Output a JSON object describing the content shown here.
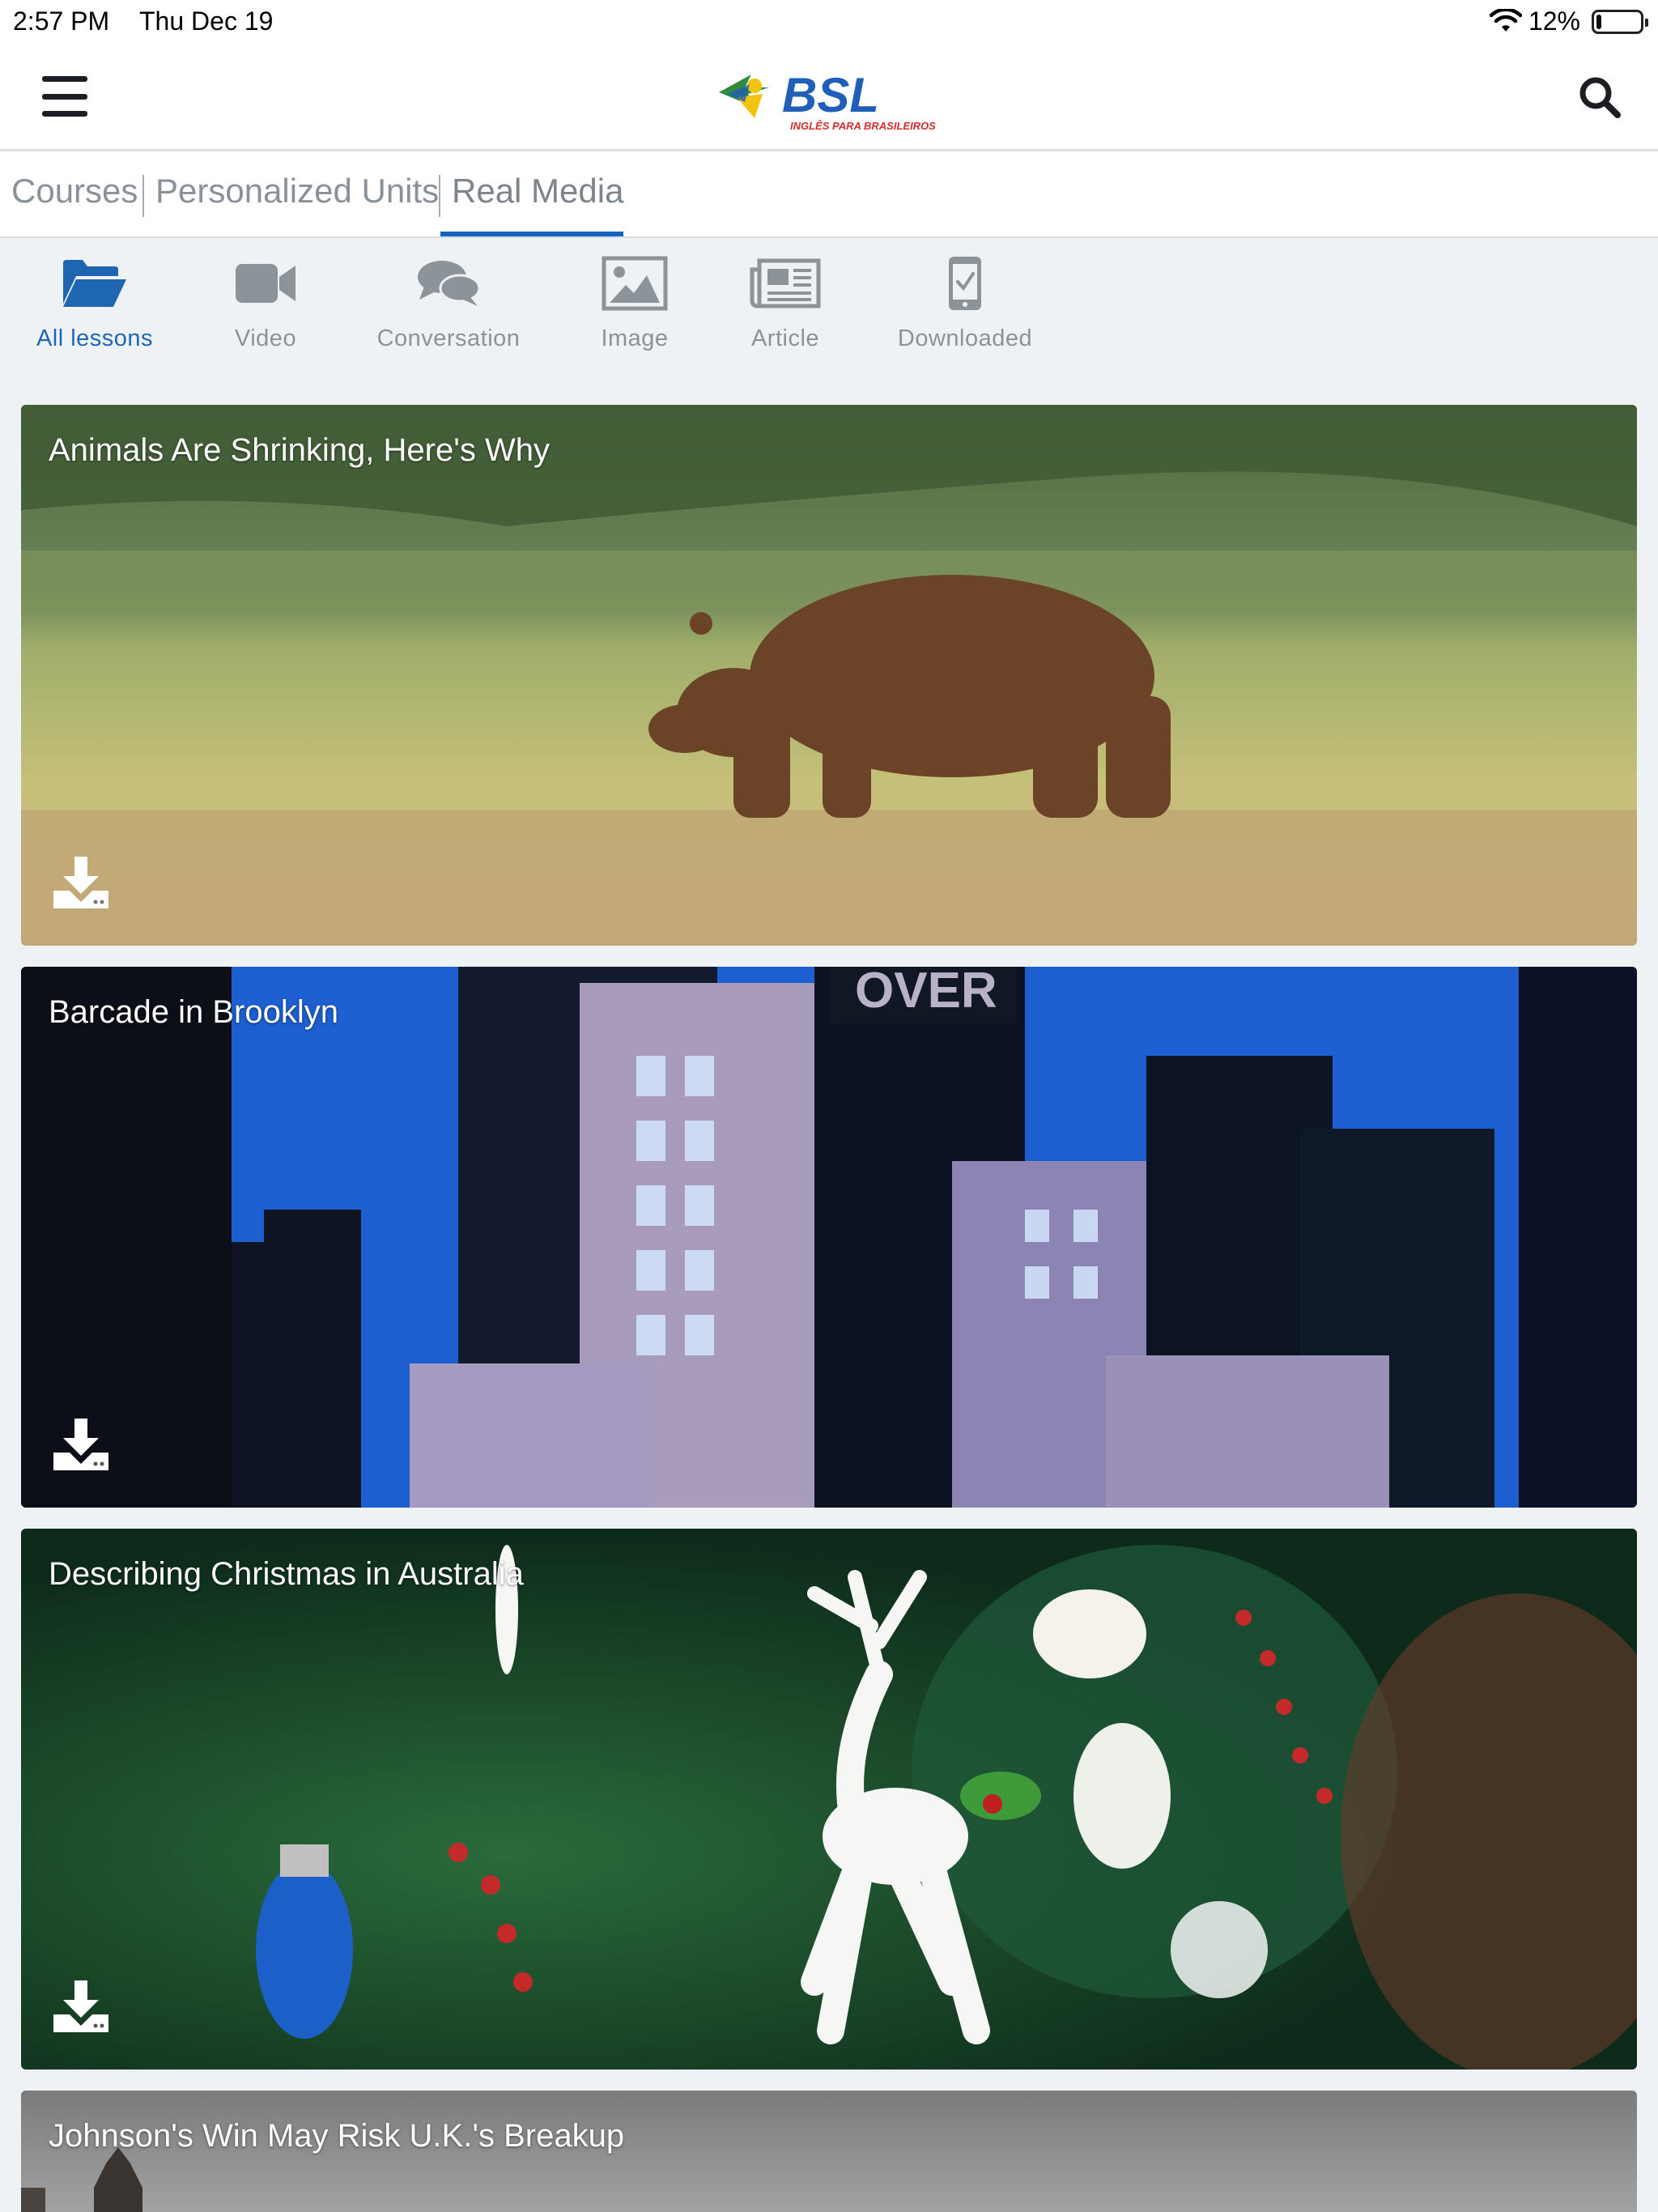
{
  "status_bar": {
    "time": "2:57 PM",
    "date": "Thu Dec 19",
    "battery": "12%",
    "battery_level": 0.12
  },
  "header": {
    "logo_text": "BSL",
    "logo_tagline": "INGLÊS PARA BRASILEIROS",
    "menu_icon": "hamburger-menu-icon",
    "search_icon": "search-icon"
  },
  "tabs": [
    {
      "label": "Courses",
      "active": false
    },
    {
      "label": "Personalized Units",
      "active": false
    },
    {
      "label": "Real Media",
      "active": true
    }
  ],
  "filters": [
    {
      "label": "All lessons",
      "icon": "folder-open-icon",
      "active": true
    },
    {
      "label": "Video",
      "icon": "video-camera-icon",
      "active": false
    },
    {
      "label": "Conversation",
      "icon": "chat-bubbles-icon",
      "active": false
    },
    {
      "label": "Image",
      "icon": "picture-icon",
      "active": false
    },
    {
      "label": "Article",
      "icon": "newspaper-icon",
      "active": false
    },
    {
      "label": "Downloaded",
      "icon": "phone-check-icon",
      "active": false
    }
  ],
  "lessons": [
    {
      "title": "Animals Are Shrinking, Here's Why",
      "thumbnail": "brown bear walking in grass field"
    },
    {
      "title": "Barcade in Brooklyn",
      "thumbnail": "blue city skyline arcade screen"
    },
    {
      "title": "Describing Christmas in Australia",
      "thumbnail": "white reindeer ornament on christmas tree"
    },
    {
      "title": "Johnson's Win May Risk U.K.'s Breakup",
      "thumbnail": "tower under grey sky"
    }
  ],
  "colors": {
    "accent": "#1565c0",
    "active_filter": "#1f66b2",
    "inactive_text": "#8b939a",
    "background": "#eef2f5"
  }
}
